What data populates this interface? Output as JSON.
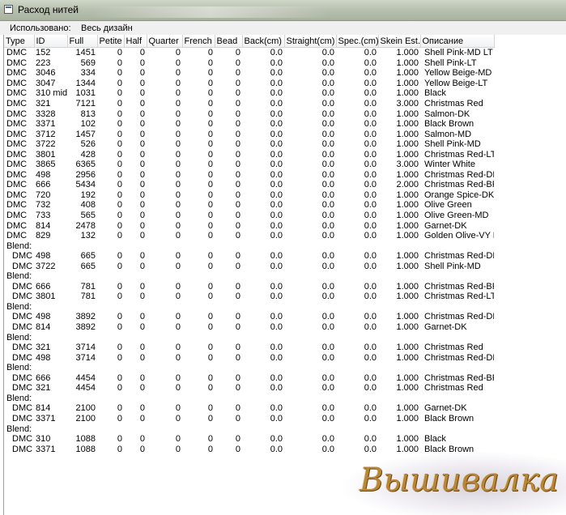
{
  "window": {
    "title": "Расход нитей"
  },
  "filter": {
    "label": "Использовано:",
    "value": "Весь дизайн"
  },
  "columns": [
    "Type",
    "ID",
    "Full",
    "Petite",
    "Half",
    "Quarter",
    "French",
    "Bead",
    "Back(cm)",
    "Straight(cm)",
    "Spec.(cm)",
    "Skein Est.",
    "Описание"
  ],
  "rows": [
    {
      "kind": "thread",
      "values": [
        "DMC",
        "152",
        "1451",
        "0",
        "0",
        "0",
        "0",
        "0",
        "0.0",
        "0.0",
        "0.0",
        "1.000",
        "Shell Pink-MD LT"
      ]
    },
    {
      "kind": "thread",
      "values": [
        "DMC",
        "223",
        "569",
        "0",
        "0",
        "0",
        "0",
        "0",
        "0.0",
        "0.0",
        "0.0",
        "1.000",
        "Shell Pink-LT"
      ]
    },
    {
      "kind": "thread",
      "values": [
        "DMC",
        "3046",
        "334",
        "0",
        "0",
        "0",
        "0",
        "0",
        "0.0",
        "0.0",
        "0.0",
        "1.000",
        "Yellow Beige-MD"
      ]
    },
    {
      "kind": "thread",
      "values": [
        "DMC",
        "3047",
        "1344",
        "0",
        "0",
        "0",
        "0",
        "0",
        "0.0",
        "0.0",
        "0.0",
        "1.000",
        "Yellow Beige-LT"
      ]
    },
    {
      "kind": "thread",
      "values": [
        "DMC",
        "310 mid",
        "1031",
        "0",
        "0",
        "0",
        "0",
        "0",
        "0.0",
        "0.0",
        "0.0",
        "1.000",
        "Black"
      ]
    },
    {
      "kind": "thread",
      "values": [
        "DMC",
        "321",
        "7121",
        "0",
        "0",
        "0",
        "0",
        "0",
        "0.0",
        "0.0",
        "0.0",
        "3.000",
        "Christmas Red"
      ]
    },
    {
      "kind": "thread",
      "values": [
        "DMC",
        "3328",
        "813",
        "0",
        "0",
        "0",
        "0",
        "0",
        "0.0",
        "0.0",
        "0.0",
        "1.000",
        "Salmon-DK"
      ]
    },
    {
      "kind": "thread",
      "values": [
        "DMC",
        "3371",
        "102",
        "0",
        "0",
        "0",
        "0",
        "0",
        "0.0",
        "0.0",
        "0.0",
        "1.000",
        "Black Brown"
      ]
    },
    {
      "kind": "thread",
      "values": [
        "DMC",
        "3712",
        "1457",
        "0",
        "0",
        "0",
        "0",
        "0",
        "0.0",
        "0.0",
        "0.0",
        "1.000",
        "Salmon-MD"
      ]
    },
    {
      "kind": "thread",
      "values": [
        "DMC",
        "3722",
        "526",
        "0",
        "0",
        "0",
        "0",
        "0",
        "0.0",
        "0.0",
        "0.0",
        "1.000",
        "Shell Pink-MD"
      ]
    },
    {
      "kind": "thread",
      "values": [
        "DMC",
        "3801",
        "428",
        "0",
        "0",
        "0",
        "0",
        "0",
        "0.0",
        "0.0",
        "0.0",
        "1.000",
        "Christmas Red-LT"
      ]
    },
    {
      "kind": "thread",
      "values": [
        "DMC",
        "3865",
        "6365",
        "0",
        "0",
        "0",
        "0",
        "0",
        "0.0",
        "0.0",
        "0.0",
        "3.000",
        "Winter White"
      ]
    },
    {
      "kind": "thread",
      "values": [
        "DMC",
        "498",
        "2956",
        "0",
        "0",
        "0",
        "0",
        "0",
        "0.0",
        "0.0",
        "0.0",
        "1.000",
        "Christmas Red-DK"
      ]
    },
    {
      "kind": "thread",
      "values": [
        "DMC",
        "666",
        "5434",
        "0",
        "0",
        "0",
        "0",
        "0",
        "0.0",
        "0.0",
        "0.0",
        "2.000",
        "Christmas Red-BRT"
      ]
    },
    {
      "kind": "thread",
      "values": [
        "DMC",
        "720",
        "192",
        "0",
        "0",
        "0",
        "0",
        "0",
        "0.0",
        "0.0",
        "0.0",
        "1.000",
        "Orange Spice-DK"
      ]
    },
    {
      "kind": "thread",
      "values": [
        "DMC",
        "732",
        "408",
        "0",
        "0",
        "0",
        "0",
        "0",
        "0.0",
        "0.0",
        "0.0",
        "1.000",
        "Olive Green"
      ]
    },
    {
      "kind": "thread",
      "values": [
        "DMC",
        "733",
        "565",
        "0",
        "0",
        "0",
        "0",
        "0",
        "0.0",
        "0.0",
        "0.0",
        "1.000",
        "Olive Green-MD"
      ]
    },
    {
      "kind": "thread",
      "values": [
        "DMC",
        "814",
        "2478",
        "0",
        "0",
        "0",
        "0",
        "0",
        "0.0",
        "0.0",
        "0.0",
        "1.000",
        "Garnet-DK"
      ]
    },
    {
      "kind": "thread",
      "values": [
        "DMC",
        "829",
        "132",
        "0",
        "0",
        "0",
        "0",
        "0",
        "0.0",
        "0.0",
        "0.0",
        "1.000",
        "Golden Olive-VY DK"
      ]
    },
    {
      "kind": "blend",
      "label": "Blend:"
    },
    {
      "kind": "sub",
      "values": [
        "DMC",
        "498",
        "665",
        "0",
        "0",
        "0",
        "0",
        "0",
        "0.0",
        "0.0",
        "0.0",
        "1.000",
        "Christmas Red-DK"
      ]
    },
    {
      "kind": "sub",
      "values": [
        "DMC",
        "3722",
        "665",
        "0",
        "0",
        "0",
        "0",
        "0",
        "0.0",
        "0.0",
        "0.0",
        "1.000",
        "Shell Pink-MD"
      ]
    },
    {
      "kind": "blend",
      "label": "Blend:"
    },
    {
      "kind": "sub",
      "values": [
        "DMC",
        "666",
        "781",
        "0",
        "0",
        "0",
        "0",
        "0",
        "0.0",
        "0.0",
        "0.0",
        "1.000",
        "Christmas Red-BRT"
      ]
    },
    {
      "kind": "sub",
      "values": [
        "DMC",
        "3801",
        "781",
        "0",
        "0",
        "0",
        "0",
        "0",
        "0.0",
        "0.0",
        "0.0",
        "1.000",
        "Christmas Red-LT"
      ]
    },
    {
      "kind": "blend",
      "label": "Blend:"
    },
    {
      "kind": "sub",
      "values": [
        "DMC",
        "498",
        "3892",
        "0",
        "0",
        "0",
        "0",
        "0",
        "0.0",
        "0.0",
        "0.0",
        "1.000",
        "Christmas Red-DK"
      ]
    },
    {
      "kind": "sub",
      "values": [
        "DMC",
        "814",
        "3892",
        "0",
        "0",
        "0",
        "0",
        "0",
        "0.0",
        "0.0",
        "0.0",
        "1.000",
        "Garnet-DK"
      ]
    },
    {
      "kind": "blend",
      "label": "Blend:"
    },
    {
      "kind": "sub",
      "values": [
        "DMC",
        "321",
        "3714",
        "0",
        "0",
        "0",
        "0",
        "0",
        "0.0",
        "0.0",
        "0.0",
        "1.000",
        "Christmas Red"
      ]
    },
    {
      "kind": "sub",
      "values": [
        "DMC",
        "498",
        "3714",
        "0",
        "0",
        "0",
        "0",
        "0",
        "0.0",
        "0.0",
        "0.0",
        "1.000",
        "Christmas Red-DK"
      ]
    },
    {
      "kind": "blend",
      "label": "Blend:"
    },
    {
      "kind": "sub",
      "values": [
        "DMC",
        "666",
        "4454",
        "0",
        "0",
        "0",
        "0",
        "0",
        "0.0",
        "0.0",
        "0.0",
        "1.000",
        "Christmas Red-BRT"
      ]
    },
    {
      "kind": "sub",
      "values": [
        "DMC",
        "321",
        "4454",
        "0",
        "0",
        "0",
        "0",
        "0",
        "0.0",
        "0.0",
        "0.0",
        "1.000",
        "Christmas Red"
      ]
    },
    {
      "kind": "blend",
      "label": "Blend:"
    },
    {
      "kind": "sub",
      "values": [
        "DMC",
        "814",
        "2100",
        "0",
        "0",
        "0",
        "0",
        "0",
        "0.0",
        "0.0",
        "0.0",
        "1.000",
        "Garnet-DK"
      ]
    },
    {
      "kind": "sub",
      "values": [
        "DMC",
        "3371",
        "2100",
        "0",
        "0",
        "0",
        "0",
        "0",
        "0.0",
        "0.0",
        "0.0",
        "1.000",
        "Black Brown"
      ]
    },
    {
      "kind": "blend",
      "label": "Blend:"
    },
    {
      "kind": "sub",
      "values": [
        "DMC",
        "310",
        "1088",
        "0",
        "0",
        "0",
        "0",
        "0",
        "0.0",
        "0.0",
        "0.0",
        "1.000",
        "Black"
      ]
    },
    {
      "kind": "sub",
      "values": [
        "DMC",
        "3371",
        "1088",
        "0",
        "0",
        "0",
        "0",
        "0",
        "0.0",
        "0.0",
        "0.0",
        "1.000",
        "Black Brown"
      ]
    }
  ],
  "watermark": {
    "text": "Вышивалка",
    "color": "#b8863a"
  }
}
